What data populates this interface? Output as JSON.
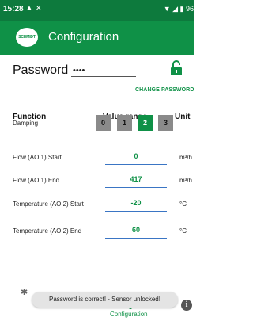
{
  "status_bar": {
    "time": "15:28",
    "right_text": "▼ ◢ ▮ 96"
  },
  "app_bar": {
    "logo_text": "SCHMIDT",
    "title": "Configuration"
  },
  "password": {
    "label": "Password",
    "value": "••••",
    "change_link": "CHANGE PASSWORD"
  },
  "table": {
    "headers": {
      "function": "Function",
      "value_range": "Value range",
      "unit": "Unit"
    },
    "damping": {
      "label": "Damping",
      "options": [
        "0",
        "1",
        "2",
        "3"
      ],
      "selected": "2"
    },
    "rows": [
      {
        "label": "Flow (AO 1) Start",
        "value": "0",
        "unit": "m³/h"
      },
      {
        "label": "Flow (AO 1) End",
        "value": "417",
        "unit": "m³/h"
      },
      {
        "label": "Temperature (AO 2) Start",
        "value": "-20",
        "unit": "°C"
      },
      {
        "label": "Temperature (AO 2) End",
        "value": "60",
        "unit": "°C"
      }
    ]
  },
  "toast": "Password is correct! - Sensor unlocked!",
  "bottom_nav": {
    "active_label": "Configuration",
    "info_glyph": "i"
  },
  "colors": {
    "primary": "#0f9147",
    "status_bar": "#0d7a3d",
    "segment_inactive": "#8a8a8a",
    "field_underline": "#3a75c4"
  }
}
